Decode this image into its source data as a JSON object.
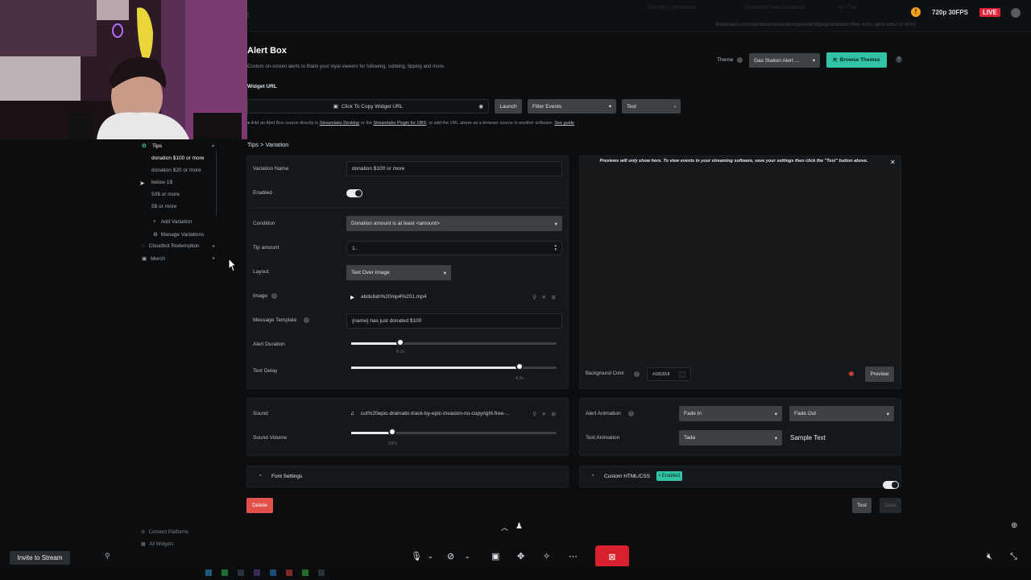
{
  "browser": {
    "tabs": [
      "Alert Box | Streamlabs",
      "Streamlabs Web Dashboard",
      "Alt + Tab"
    ],
    "url": "streamlabs.com/dashboard#/alertbox/general/tipping/localid/82-f6ec-4162-abc9-bb62797d0f0f",
    "stream_quality": "720p 30FPS",
    "live_label": "LIVE"
  },
  "page": {
    "title": "Alert Box",
    "subtitle": "Custom on-screen alerts to thank your loyal viewers for following, subbing, tipping and more.",
    "theme_label": "Theme",
    "theme_value": "Gas Station Alert ...",
    "browse_themes": "Browse Themes",
    "widget_url_label": "Widget URL",
    "copy_url": "Click To Copy Widget URL",
    "launch": "Launch",
    "filter_events": "Filter Events",
    "test_dropdown": "Test",
    "hint_prefix": "Add an Alert Box source directly in ",
    "hint_link1": "Streamlabs Desktop",
    "hint_mid": " or the ",
    "hint_link2": "Streamlabs Plugin for OBS",
    "hint_suffix": ", or add the URL above as a browser source in another software. ",
    "hint_link3": "See guide",
    "breadcrumb": "Tips > Variation"
  },
  "sidebar": {
    "group": "Tips",
    "items": [
      {
        "label": "donation $100 or more",
        "active": true
      },
      {
        "label": "donation $20 or more"
      },
      {
        "label": "below 1$"
      },
      {
        "label": "50$ or more"
      },
      {
        "label": "5$ or more"
      }
    ],
    "add_variation": "Add Variation",
    "manage_variations": "Manage Variations",
    "cloudbot": "Cloudbot Redemption",
    "merch": "Merch",
    "connect_platforms": "Connect Platforms",
    "all_widgets": "All Widgets"
  },
  "form": {
    "variation_name_label": "Variation Name",
    "variation_name_value": "donation $100 or more",
    "enabled_label": "Enabled",
    "condition_label": "Condition",
    "condition_value": "Donation amount is at least <amount>",
    "tip_amount_label": "Tip amount",
    "tip_amount_value": "1..",
    "layout_label": "Layout",
    "layout_value": "Text Over Image",
    "image_label": "Image",
    "image_value": "abdullah%20mp4%201.mp4",
    "message_template_label": "Message Template",
    "message_template_value": "{name} has just donated $100",
    "alert_duration_label": "Alert Duration",
    "alert_duration_value": "8.2s",
    "alert_duration_fraction": 0.24,
    "text_delay_label": "Text Delay",
    "text_delay_value": "4.9s",
    "text_delay_fraction": 0.82,
    "sound_label": "Sound",
    "sound_value": "cut%20epic-dramatic-track-by-epic-invasion-no-copyright-free-...",
    "sound_volume_label": "Sound Volume",
    "sound_volume_value": "20%",
    "sound_volume_fraction": 0.2,
    "font_settings": "Font Settings",
    "delete": "Delete"
  },
  "preview": {
    "notice": "Previews will only show here. To view events in your streaming software, save your settings then click the \"Test\" button above.",
    "bg_color_label": "Background Color",
    "bg_color_value": "#181818",
    "preview_button": "Preview",
    "alert_animation_label": "Alert Animation",
    "alert_anim_in": "Fade In",
    "alert_anim_out": "Fade Out",
    "text_animation_label": "Text Animation",
    "text_animation_value": "Tada",
    "sample_text": "Sample Text",
    "custom_html": "Custom HTML/CSS",
    "enabled_badge": "• Enabled",
    "test": "Test",
    "save": "Save"
  },
  "bottom": {
    "invite": "Invite to Stream"
  },
  "colors": {
    "accent_green": "#32c3a6",
    "live_red": "#e0223a",
    "delete_red": "#e2504c",
    "end_call_red": "#d9202e"
  }
}
